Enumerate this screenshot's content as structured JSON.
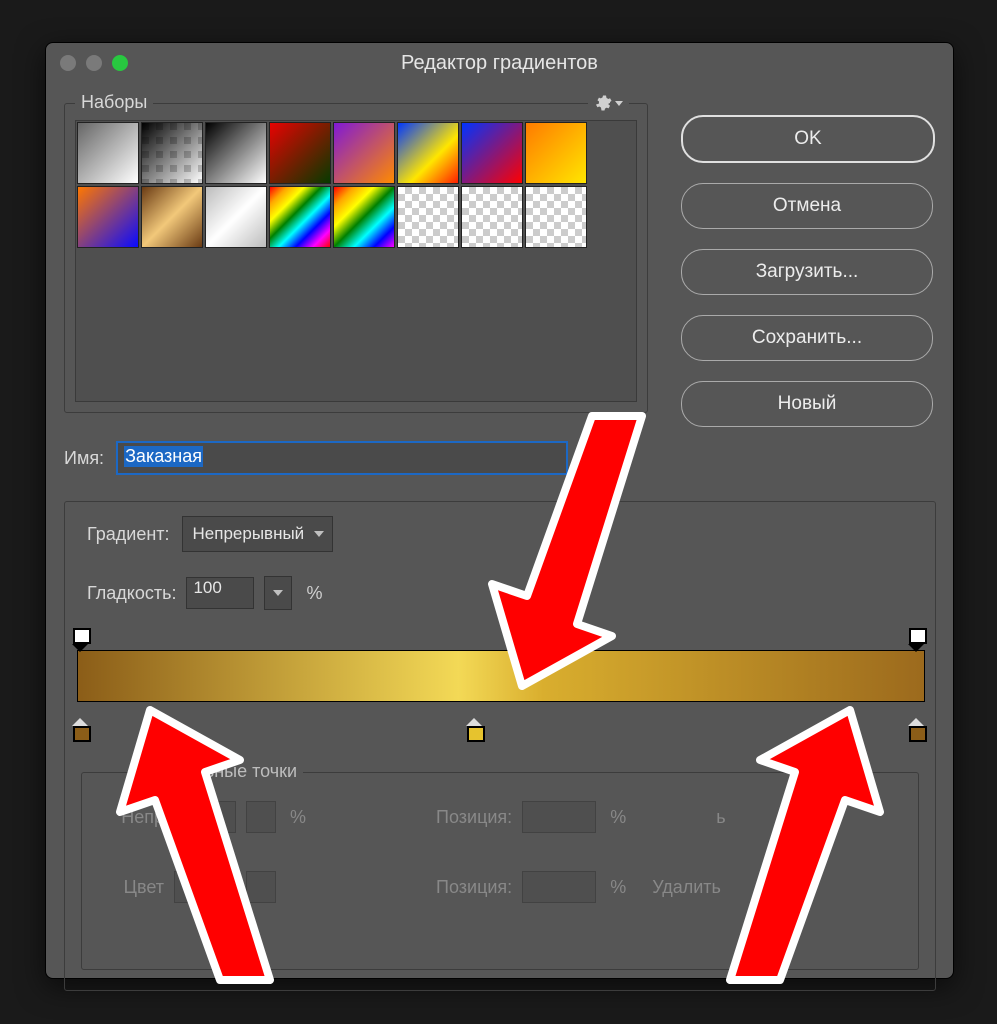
{
  "window": {
    "title": "Редактор градиентов"
  },
  "buttons": {
    "ok": "OK",
    "cancel": "Отмена",
    "load": "Загрузить...",
    "save": "Сохранить...",
    "new": "Новый"
  },
  "presets": {
    "label": "Наборы",
    "gear": "gear-icon"
  },
  "name": {
    "label": "Имя:",
    "value": "Заказная"
  },
  "gradient": {
    "typeLabel": "Градиент:",
    "typeValue": "Непрерывный",
    "smoothLabel": "Гладкость:",
    "smoothValue": "100",
    "percent": "%"
  },
  "stops": {
    "legend": "Контрольные точки",
    "opacityLabel": "Непр",
    "colorLabel": "Цвет",
    "percent": "%",
    "positionLabel": "Позиция:",
    "actionTop": "ь",
    "deleteLabel": "Удалить"
  },
  "gradientStops": {
    "opacity": [
      {
        "position": 0
      },
      {
        "position": 100
      }
    ],
    "color": [
      {
        "position": 0,
        "color": "#8b5d18"
      },
      {
        "position": 47,
        "color": "#e6c32e"
      },
      {
        "position": 100,
        "color": "#8b5d18"
      }
    ]
  },
  "annotations": {
    "arrows": [
      "top-center-stop",
      "bottom-left-stop",
      "bottom-right-stop"
    ]
  }
}
